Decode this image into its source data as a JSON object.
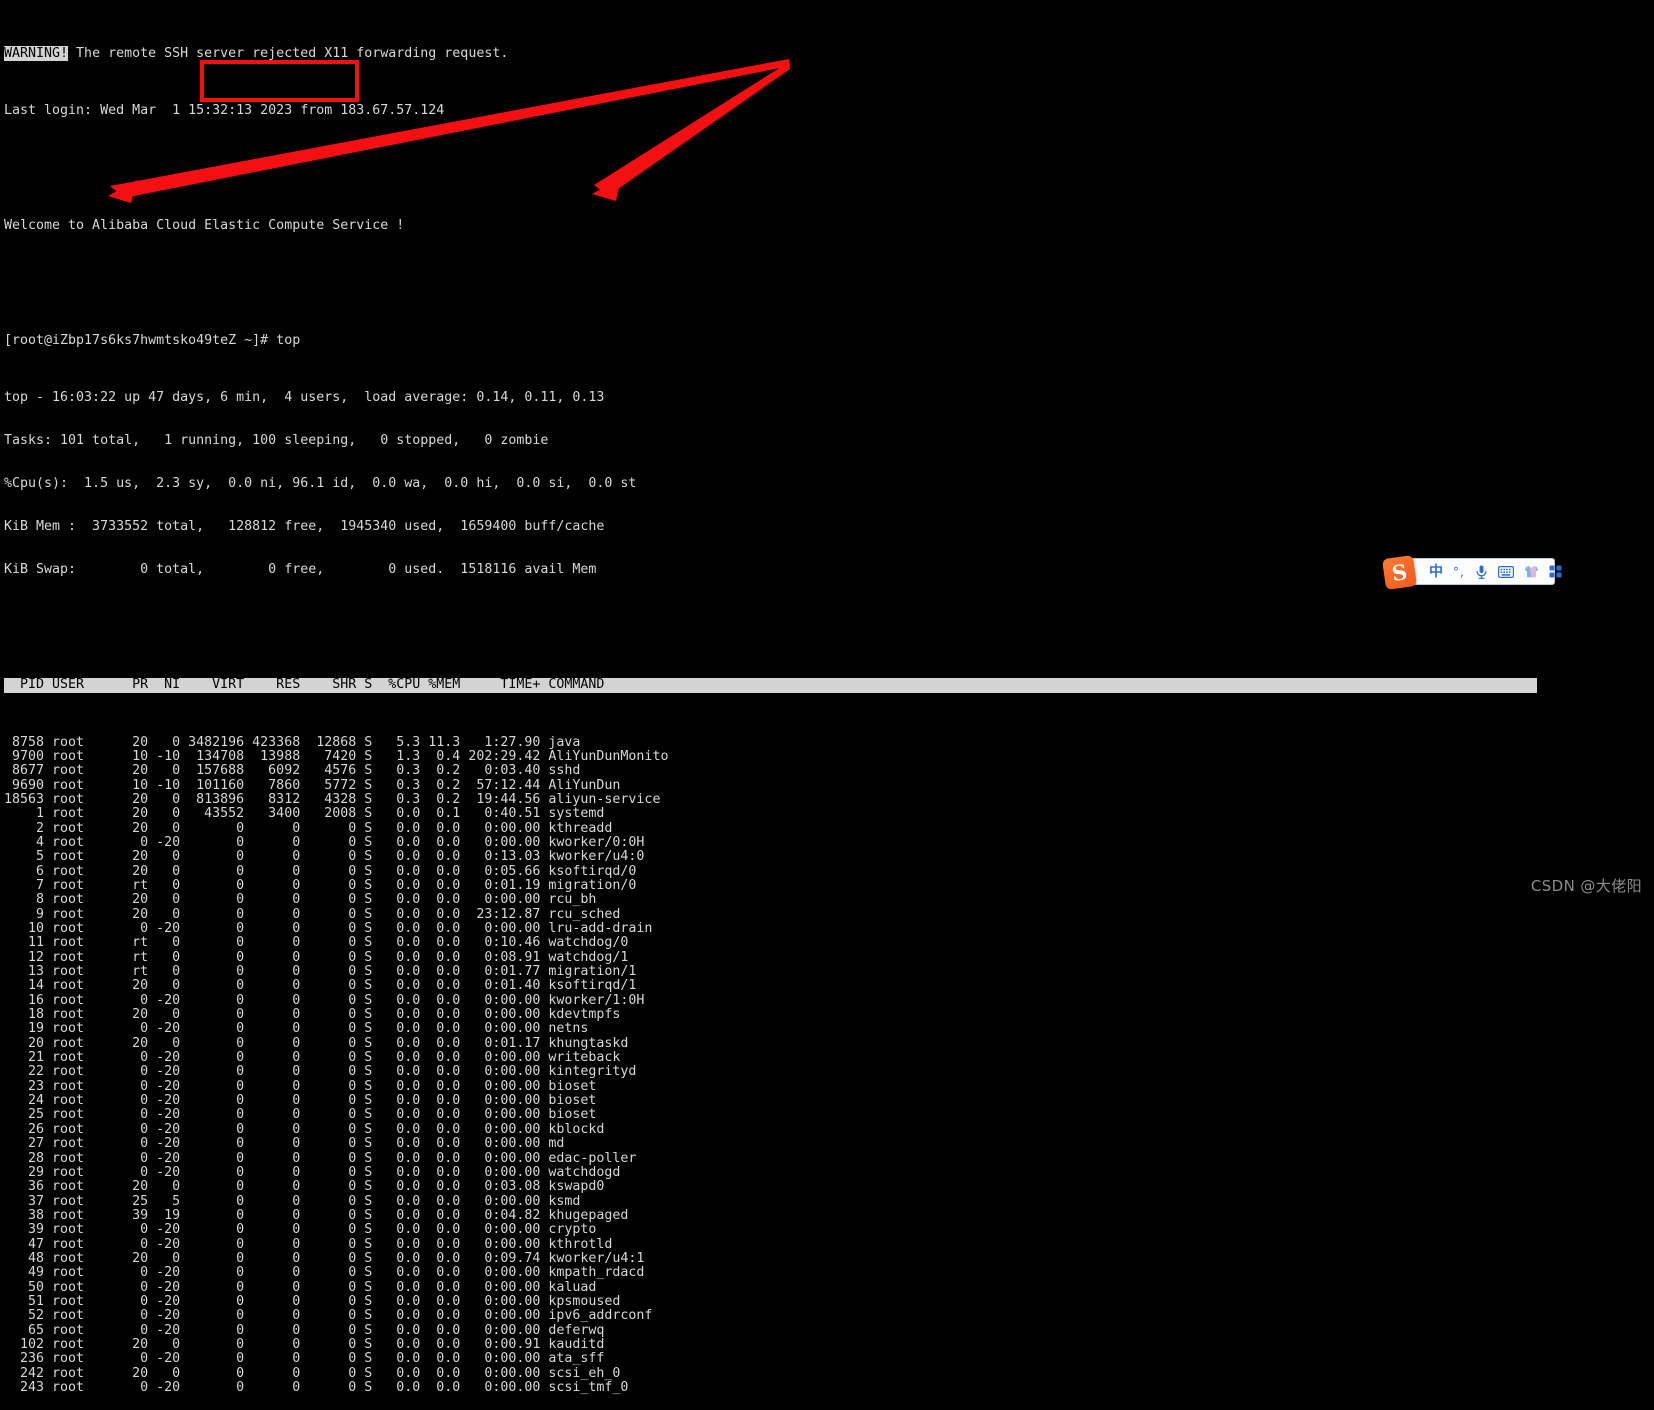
{
  "terminal": {
    "warning_badge": "WARNING!",
    "warning_text": " The remote SSH server rejected X11 forwarding request.",
    "last_login": "Last login: Wed Mar  1 15:32:13 2023 from 183.67.57.124",
    "welcome": "Welcome to Alibaba Cloud Elastic Compute Service !",
    "prompt": "[root@iZbp17s6ks7hwmtsko49teZ ~]# top",
    "summary": {
      "uptime_line": "top - 16:03:22 up 47 days, 6 min,  4 users,  load average: 0.14, 0.11, 0.13",
      "tasks_line": "Tasks: 101 total,   1 running, 100 sleeping,   0 stopped,   0 zombie",
      "cpu_line": "%Cpu(s):  1.5 us,  2.3 sy,  0.0 ni, 96.1 id,  0.0 wa,  0.0 hi,  0.0 si,  0.0 st",
      "mem_line": "KiB Mem :  3733552 total,   128812 free,  1945340 used,  1659400 buff/cache",
      "swap_line": "KiB Swap:        0 total,        0 free,        0 used.  1518116 avail Mem"
    },
    "table": {
      "header": "  PID USER      PR  NI    VIRT    RES    SHR S  %CPU %MEM     TIME+ COMMAND",
      "rows": [
        " 8758 root      20   0 3482196 423368  12868 S   5.3 11.3   1:27.90 java",
        " 9700 root      10 -10  134708  13988   7420 S   1.3  0.4 202:29.42 AliYunDunMonito",
        " 8677 root      20   0  157688   6092   4576 S   0.3  0.2   0:03.40 sshd",
        " 9690 root      10 -10  101160   7860   5772 S   0.3  0.2  57:12.44 AliYunDun",
        "18563 root      20   0  813896   8312   4328 S   0.3  0.2  19:44.56 aliyun-service",
        "    1 root      20   0   43552   3400   2008 S   0.0  0.1   0:40.51 systemd",
        "    2 root      20   0       0      0      0 S   0.0  0.0   0:00.00 kthreadd",
        "    4 root       0 -20       0      0      0 S   0.0  0.0   0:00.00 kworker/0:0H",
        "    5 root      20   0       0      0      0 S   0.0  0.0   0:13.03 kworker/u4:0",
        "    6 root      20   0       0      0      0 S   0.0  0.0   0:05.66 ksoftirqd/0",
        "    7 root      rt   0       0      0      0 S   0.0  0.0   0:01.19 migration/0",
        "    8 root      20   0       0      0      0 S   0.0  0.0   0:00.00 rcu_bh",
        "    9 root      20   0       0      0      0 S   0.0  0.0  23:12.87 rcu_sched",
        "   10 root       0 -20       0      0      0 S   0.0  0.0   0:00.00 lru-add-drain",
        "   11 root      rt   0       0      0      0 S   0.0  0.0   0:10.46 watchdog/0",
        "   12 root      rt   0       0      0      0 S   0.0  0.0   0:08.91 watchdog/1",
        "   13 root      rt   0       0      0      0 S   0.0  0.0   0:01.77 migration/1",
        "   14 root      20   0       0      0      0 S   0.0  0.0   0:01.40 ksoftirqd/1",
        "   16 root       0 -20       0      0      0 S   0.0  0.0   0:00.00 kworker/1:0H",
        "   18 root      20   0       0      0      0 S   0.0  0.0   0:00.00 kdevtmpfs",
        "   19 root       0 -20       0      0      0 S   0.0  0.0   0:00.00 netns",
        "   20 root      20   0       0      0      0 S   0.0  0.0   0:01.17 khungtaskd",
        "   21 root       0 -20       0      0      0 S   0.0  0.0   0:00.00 writeback",
        "   22 root       0 -20       0      0      0 S   0.0  0.0   0:00.00 kintegrityd",
        "   23 root       0 -20       0      0      0 S   0.0  0.0   0:00.00 bioset",
        "   24 root       0 -20       0      0      0 S   0.0  0.0   0:00.00 bioset",
        "   25 root       0 -20       0      0      0 S   0.0  0.0   0:00.00 bioset",
        "   26 root       0 -20       0      0      0 S   0.0  0.0   0:00.00 kblockd",
        "   27 root       0 -20       0      0      0 S   0.0  0.0   0:00.00 md",
        "   28 root       0 -20       0      0      0 S   0.0  0.0   0:00.00 edac-poller",
        "   29 root       0 -20       0      0      0 S   0.0  0.0   0:00.00 watchdogd",
        "   36 root      20   0       0      0      0 S   0.0  0.0   0:03.08 kswapd0",
        "   37 root      25   5       0      0      0 S   0.0  0.0   0:00.00 ksmd",
        "   38 root      39  19       0      0      0 S   0.0  0.0   0:04.82 khugepaged",
        "   39 root       0 -20       0      0      0 S   0.0  0.0   0:00.00 crypto",
        "   47 root       0 -20       0      0      0 S   0.0  0.0   0:00.00 kthrotld",
        "   48 root      20   0       0      0      0 S   0.0  0.0   0:09.74 kworker/u4:1",
        "   49 root       0 -20       0      0      0 S   0.0  0.0   0:00.00 kmpath_rdacd",
        "   50 root       0 -20       0      0      0 S   0.0  0.0   0:00.00 kaluad",
        "   51 root       0 -20       0      0      0 S   0.0  0.0   0:00.00 kpsmoused",
        "   52 root       0 -20       0      0      0 S   0.0  0.0   0:00.00 ipv6_addrconf",
        "   65 root       0 -20       0      0      0 S   0.0  0.0   0:00.00 deferwq",
        "  102 root      20   0       0      0      0 S   0.0  0.0   0:00.91 kauditd",
        "  236 root       0 -20       0      0      0 S   0.0  0.0   0:00.00 ata_sff",
        "  242 root      20   0       0      0      0 S   0.0  0.0   0:00.00 scsi_eh_0",
        "  243 root       0 -20       0      0      0 S   0.0  0.0   0:00.00 scsi_tmf_0"
      ]
    }
  },
  "annotations": {
    "color": "#f41010",
    "highlight_box_label": "command-highlight-rectangle",
    "arrow1_label": "arrow-to-pid-user-column",
    "arrow2_label": "arrow-to-cpu-mem-column"
  },
  "ime": {
    "logo_text": "S",
    "items": [
      {
        "name": "ime-language-toggle",
        "glyph": "中"
      },
      {
        "name": "ime-punctuation-toggle",
        "glyph": "°,"
      },
      {
        "name": "ime-voice-input",
        "glyph": "mic-icon"
      },
      {
        "name": "ime-soft-keyboard",
        "glyph": "keyboard-icon"
      },
      {
        "name": "ime-skin",
        "glyph": "tshirt-icon"
      },
      {
        "name": "ime-toolbox",
        "glyph": "grid-icon"
      }
    ]
  },
  "watermark": {
    "text": "CSDN @大佬阳"
  }
}
